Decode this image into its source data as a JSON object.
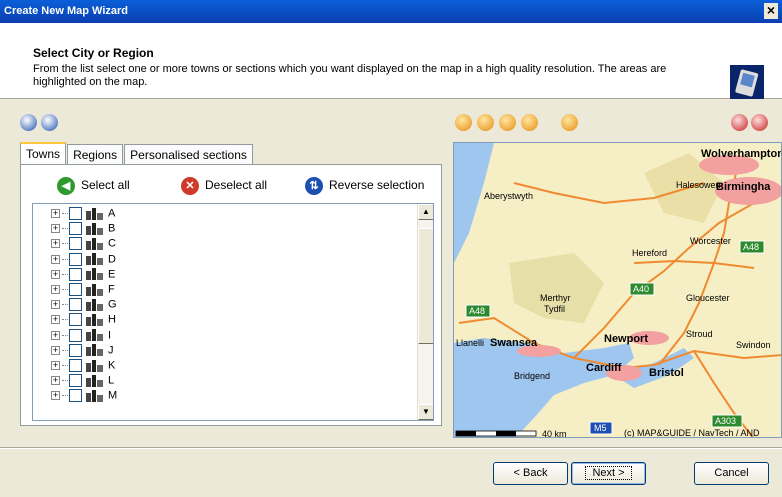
{
  "window": {
    "title": "Create New Map Wizard",
    "close": "×"
  },
  "header": {
    "title": "Select City or Region",
    "description": "From the list select one or more towns or sections which you want displayed on the map in a high quality resolution. The areas are highlighted on the map."
  },
  "tabs": [
    {
      "label": "Towns",
      "active": true
    },
    {
      "label": "Regions",
      "active": false
    },
    {
      "label": "Personalised sections",
      "active": false
    }
  ],
  "actions": {
    "select_all": "Select all",
    "deselect_all": "Deselect all",
    "reverse_selection": "Reverse selection"
  },
  "tree": {
    "expander": "+",
    "items": [
      "A",
      "B",
      "C",
      "D",
      "E",
      "F",
      "G",
      "H",
      "I",
      "J",
      "K",
      "L",
      "M"
    ]
  },
  "map": {
    "places": {
      "wolverhampton": "Wolverhampton",
      "birmingham": "Birmingha",
      "aberystwyth": "Aberystwyth",
      "halesowen": "Halesowen",
      "worcester": "Worcester",
      "hereford": "Hereford",
      "gloucester": "Gloucester",
      "merthyr": "Merthyr",
      "tydfil": "Tydfil",
      "llanelli": "Llanelli",
      "swansea": "Swansea",
      "newport": "Newport",
      "stroud": "Stroud",
      "swindon": "Swindon",
      "bridgend": "Bridgend",
      "cardiff": "Cardiff",
      "bristol": "Bristol"
    },
    "roads": {
      "a48_west": "A48",
      "a48_east": "A48",
      "a40": "A40",
      "m5": "M5",
      "a303": "A303"
    },
    "scale_label": "40 km",
    "copyright": "(c) MAP&GUIDE / NavTech / AND"
  },
  "buttons": {
    "back": "< Back",
    "next": "Next >",
    "cancel": "Cancel"
  },
  "colors": {
    "accent": "#0a5fd8",
    "map_water": "#7fb3e6",
    "map_land": "#f6efc5",
    "road": "#f08a30"
  }
}
